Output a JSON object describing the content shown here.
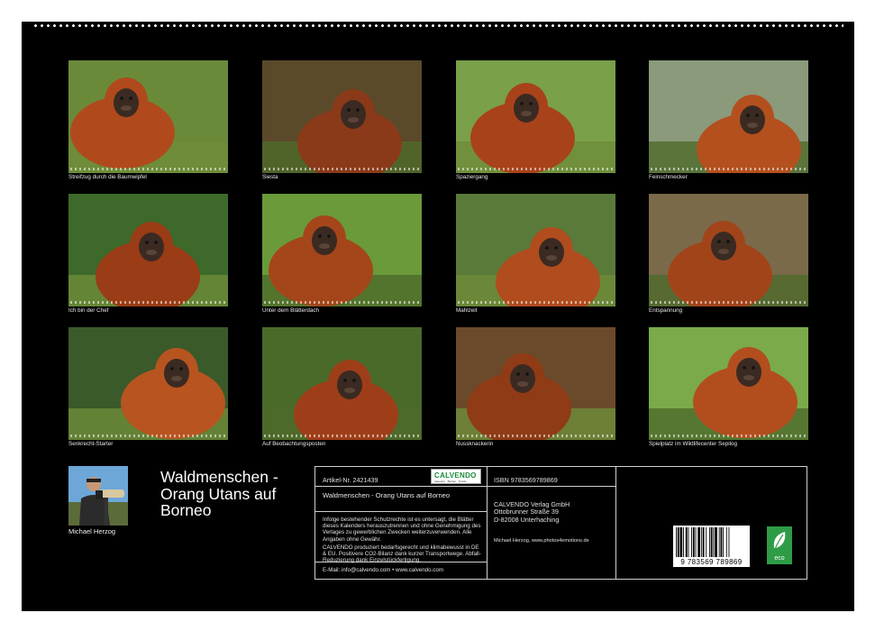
{
  "photos": [
    {
      "caption": "Streifzug durch die Baumwipfel"
    },
    {
      "caption": "Siesta"
    },
    {
      "caption": "Spaziergang"
    },
    {
      "caption": "Feinschmecker"
    },
    {
      "caption": "Ich bin der Chef"
    },
    {
      "caption": "Unter dem Blätterdach"
    },
    {
      "caption": "Mahlzeit"
    },
    {
      "caption": "Entspannung"
    },
    {
      "caption": "Senkrecht-Starter"
    },
    {
      "caption": "Auf Beobachtungsposten"
    },
    {
      "caption": "Nussknackerin"
    },
    {
      "caption": "Spielplatz im Wildlifecenter Sepilog"
    }
  ],
  "author": {
    "name": "Michael Herzog"
  },
  "title": "Waldmenschen - Orang Utans auf Borneo",
  "info": {
    "article": "Artikel-Nr. 2421439",
    "brand": "CALVENDO",
    "brand_sub": "Kalender · Bücher · Puzzle",
    "calendar_title": "Waldmenschen - Orang Utans auf Borneo",
    "legal1": "Infolge bestehender Schutzrechte ist es untersagt, die Blätter dieses Kalenders herauszutrennen und ohne Genehmigung des Verlages zu gewerblichen Zwecken weiterzuverwenden. Alle Angaben ohne Gewähr.",
    "legal2": "CALVENDO produziert bedarfsgerecht und klimabewusst in DE & EU. Positivere CO2-Bilanz dank kurzer Transportwege. Abfall-Reduzierung dank Einzelstückfertigung.",
    "email": "E-Mail: info@calvendo.com • www.calvendo.com",
    "isbn": "ISBN 9783569789869",
    "publisher_name": "CALVENDO Verlag GmbH",
    "publisher_street": "Ottobrunner Straße 39",
    "publisher_city": "D-82008 Unterhaching",
    "credit": "Michael Herzog, www.photos4emotions.de",
    "barcode_digits": "9 783569 789869",
    "eco_label": "eco"
  }
}
